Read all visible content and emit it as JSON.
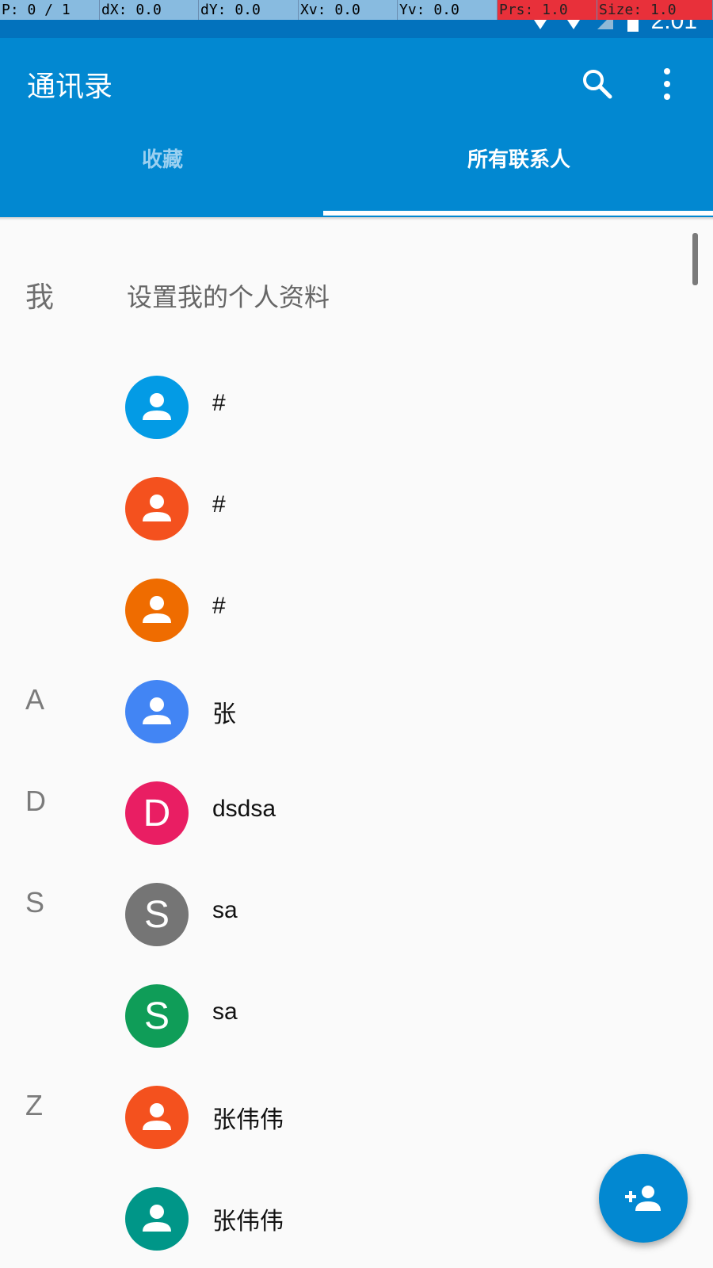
{
  "debug_bar": {
    "pointer": "P: 0 / 1",
    "dx": "dX: 0.0",
    "dy": "dY: 0.0",
    "xv": "Xv: 0.0",
    "yv": "Yv: 0.0",
    "prs": "Prs: 1.0",
    "size": "Size: 1.0"
  },
  "status_bar": {
    "time": "2:01",
    "icons": [
      "wifi-icon",
      "signal-icon",
      "no-sim-icon",
      "battery-icon"
    ]
  },
  "app_bar": {
    "title": "通讯录",
    "search_icon": "search-icon",
    "menu_icon": "more-vert-icon",
    "color": "#0288d1"
  },
  "tabs": [
    {
      "label": "收藏",
      "selected": false
    },
    {
      "label": "所有联系人",
      "selected": true
    }
  ],
  "me": {
    "letter": "我",
    "label": "设置我的个人资料"
  },
  "contacts": [
    {
      "section": "",
      "name": "#",
      "avatar": "person-icon",
      "color": "#039be5"
    },
    {
      "section": "",
      "name": "#",
      "avatar": "person-icon",
      "color": "#f4511e"
    },
    {
      "section": "",
      "name": "#",
      "avatar": "person-icon",
      "color": "#ef6c00"
    },
    {
      "section": "A",
      "name": "张",
      "avatar": "person-icon",
      "color": "#4285f4"
    },
    {
      "section": "D",
      "name": "dsdsa",
      "avatar": "D",
      "color": "#e91e63"
    },
    {
      "section": "S",
      "name": "sa",
      "avatar": "S",
      "color": "#757575"
    },
    {
      "section": "",
      "name": "sa",
      "avatar": "S",
      "color": "#0f9d58"
    },
    {
      "section": "Z",
      "name": "张伟伟",
      "avatar": "person-icon",
      "color": "#f4511e"
    },
    {
      "section": "",
      "name": "张伟伟",
      "avatar": "person-icon",
      "color": "#009688"
    }
  ],
  "fab": {
    "icon": "add-person-icon",
    "color": "#0288d1"
  }
}
